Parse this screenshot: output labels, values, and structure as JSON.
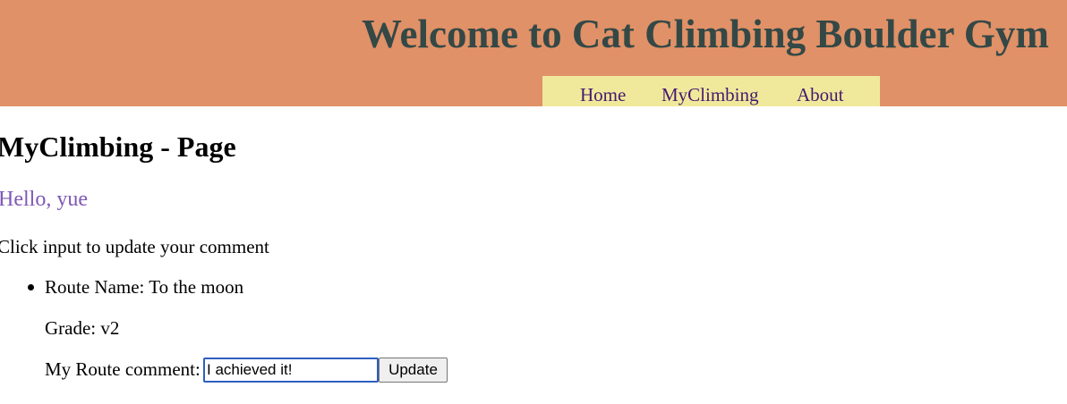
{
  "header": {
    "title": "Welcome to Cat Climbing Boulder Gym",
    "nav": {
      "home": "Home",
      "myclimbing": "MyClimbing",
      "about": "About"
    }
  },
  "main": {
    "page_title": "MyClimbing - Page",
    "greeting": "Hello, yue",
    "instruction": "Click input to update your comment",
    "routes": [
      {
        "name_text": "Route Name: To the moon",
        "grade_text": "Grade: v2",
        "comment_label": "My Route comment:",
        "comment_value": "I achieved it!",
        "update_label": "Update"
      }
    ]
  },
  "colors": {
    "header_bg": "#e09167",
    "title_text": "#344846",
    "nav_bg": "#f0e99c",
    "nav_link": "#46196d",
    "greeting": "#7f58b6",
    "input_focus_border": "#2e5fbf"
  }
}
